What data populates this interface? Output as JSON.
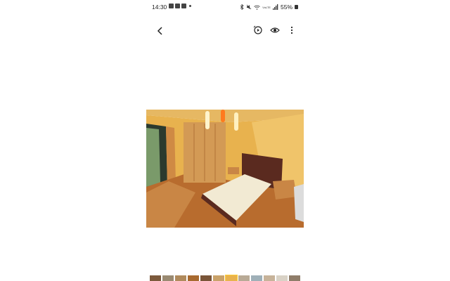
{
  "status_bar": {
    "time": "14:30",
    "battery_percent": "55%",
    "network": "VoLTE",
    "notification_icons": [
      "gallery-icon",
      "email-icon",
      "check-icon",
      "dot-icon"
    ],
    "system_icons": [
      "bluetooth-icon",
      "mute-icon",
      "wifi-icon",
      "signal-icon",
      "lock-icon"
    ]
  },
  "toolbar": {
    "back_icon": "chevron-left-icon",
    "actions": [
      "remaster-icon",
      "view-icon",
      "more-vert-icon"
    ]
  },
  "photo": {
    "subject": "bedroom",
    "colors": {
      "wall": "#e9b84f",
      "floor": "#b46a2c",
      "headboard": "#5a2a1f",
      "bed": "#f2ead3",
      "wardrobe": "#d19a56"
    }
  },
  "thumbnails": {
    "count": 13,
    "active_index": 6
  }
}
